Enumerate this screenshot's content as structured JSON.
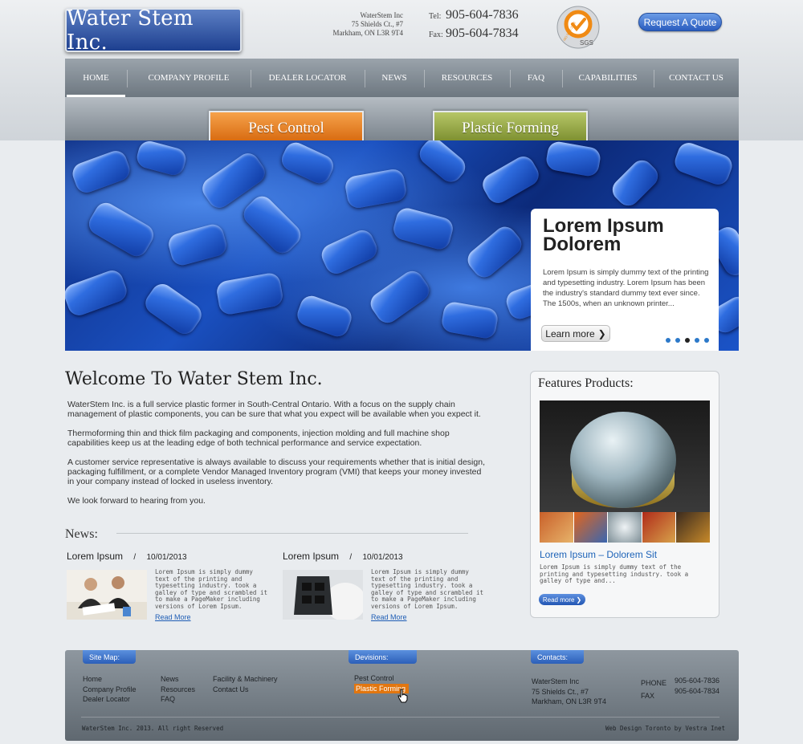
{
  "header": {
    "logo_text": "Water Stem Inc.",
    "address": [
      "WaterStem Inc",
      "75 Shields Ct., #7",
      "Markham, ON L3R 9T4"
    ],
    "tel_label": "Tel:",
    "tel": "905-604-7836",
    "fax_label": "Fax:",
    "fax": "905-604-7834",
    "cert_label": "SGS",
    "cert_ring": "ISO 9001:2008",
    "quote_button": "Request A Quote"
  },
  "nav": [
    "HOME",
    "COMPANY PROFILE",
    "DEALER LOCATOR",
    "NEWS",
    "RESOURCES",
    "FAQ",
    "CAPABILITIES",
    "CONTACT US"
  ],
  "divisions": {
    "pest": "Pest Control",
    "plastic": "Plastic Forming"
  },
  "banner": {
    "title_line1": "Lorem Ipsum",
    "title_line2": "Dolorem",
    "text": "Lorem Ipsum is simply dummy text of the printing and typesetting industry. Lorem Ipsum has been the industry's standard dummy text ever since. The 1500s, when an unknown printer...",
    "button": "Learn more",
    "button_icon": "❯",
    "slide_count": 5,
    "active_slide": 3
  },
  "welcome": {
    "title": "Welcome To Water Stem Inc.",
    "paragraphs": [
      "WaterStem Inc. is a full service plastic former in South-Central Ontario.  With a focus on the supply chain management of plastic components, you can be sure that what you expect will be available when you expect it.",
      "Thermoforming thin and thick film packaging and components, injection molding and full machine shop capabilities keep us at the leading edge of both technical performance and service expectation.",
      "A customer service representative is always available to discuss your requirements whether that is initial design, packaging fulfillment, or a complete Vendor Managed Inventory program (VMI) that keeps your money invested in your company instead of locked in useless inventory.",
      "We look forward to hearing from you."
    ]
  },
  "news": {
    "heading": "News:",
    "items": [
      {
        "title": "Lorem Ipsum",
        "sep": "/",
        "date": "10/01/2013",
        "text": "Lorem Ipsum is simply dummy text of the printing and typesetting industry. took a galley of type and scrambled it to make a PageMaker including versions of Lorem Ipsum.",
        "link": "Read More"
      },
      {
        "title": "Lorem Ipsum",
        "sep": "/",
        "date": "10/01/2013",
        "text": "Lorem Ipsum is simply dummy text of the printing and typesetting industry. took a galley of type and scrambled it to make a PageMaker including versions of Lorem Ipsum.",
        "link": "Read More"
      }
    ]
  },
  "features": {
    "heading": "Features Products:",
    "title": "Lorem Ipsum – Dolorem Sit",
    "text": "Lorem Ipsum is simply dummy text of the printing and typesetting industry. took a galley of type and...",
    "button": "Read more",
    "button_icon": "❯"
  },
  "footer": {
    "sitemap_tab": "Site Map:",
    "divisions_tab": "Devisions:",
    "contacts_tab": "Contacts:",
    "sitemap_col1": [
      "Home",
      "Company Profile",
      "Dealer Locator"
    ],
    "sitemap_col2": [
      "News",
      "Resources",
      "FAQ"
    ],
    "sitemap_col3": [
      "Facility & Machinery",
      "Contact Us"
    ],
    "divisions": [
      "Pest Control",
      "Plastic Forming"
    ],
    "contact_address": [
      "WaterStem Inc",
      "75 Shields Ct., #7",
      "Markham, ON L3R 9T4"
    ],
    "phone_label": "PHONE",
    "phone": "905-604-7836",
    "fax_label": "FAX",
    "fax": "905-604-7834",
    "copyright": "WaterStem Inc. 2013. All right Reserved",
    "credit": "Web Design Toronto by Vestra Inet"
  },
  "colors": {
    "accent_blue": "#2a5cbf",
    "pest_orange": "#d4640a",
    "plastic_green": "#76892a",
    "highlight_orange": "#e2760f"
  }
}
